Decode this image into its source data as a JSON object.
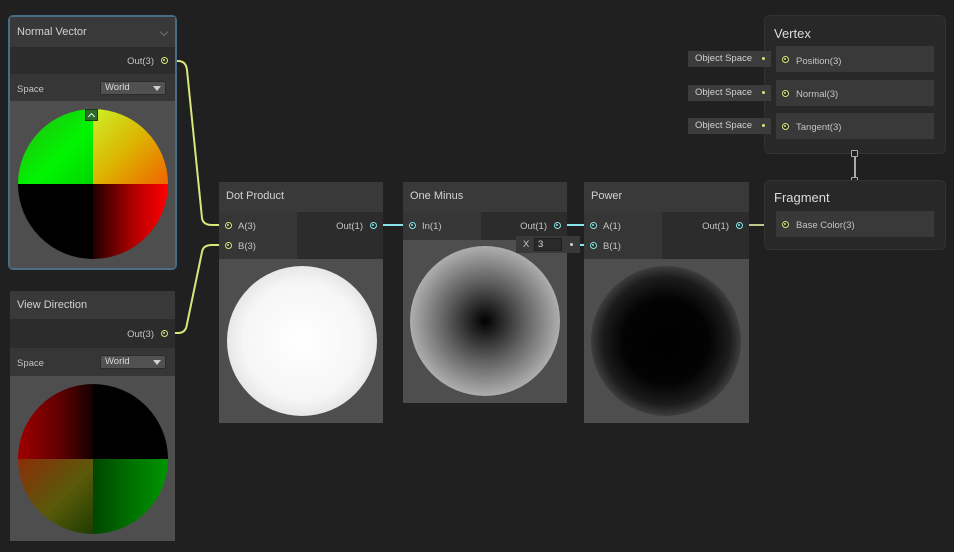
{
  "nodes": {
    "normal_vector": {
      "title": "Normal Vector",
      "output_label": "Out(3)",
      "space_label": "Space",
      "space_value": "World"
    },
    "view_direction": {
      "title": "View Direction",
      "output_label": "Out(3)",
      "space_label": "Space",
      "space_value": "World"
    },
    "dot_product": {
      "title": "Dot Product",
      "input_a": "A(3)",
      "input_b": "B(3)",
      "output_label": "Out(1)"
    },
    "one_minus": {
      "title": "One Minus",
      "input": "In(1)",
      "output_label": "Out(1)"
    },
    "power": {
      "title": "Power",
      "input_a": "A(1)",
      "input_b": "B(1)",
      "output_label": "Out(1)",
      "inline_b_axis": "X",
      "inline_b_value": "3"
    }
  },
  "vertex": {
    "title": "Vertex",
    "slots": [
      {
        "space": "Object Space",
        "label": "Position(3)"
      },
      {
        "space": "Object Space",
        "label": "Normal(3)"
      },
      {
        "space": "Object Space",
        "label": "Tangent(3)"
      }
    ]
  },
  "fragment": {
    "title": "Fragment",
    "slots": [
      {
        "label": "Base Color(3)"
      }
    ]
  },
  "colors": {
    "background": "#202020",
    "vector3_port": "#d9e67a",
    "vector1_port": "#84e4e7",
    "selection_outline": "#4a6d86"
  }
}
